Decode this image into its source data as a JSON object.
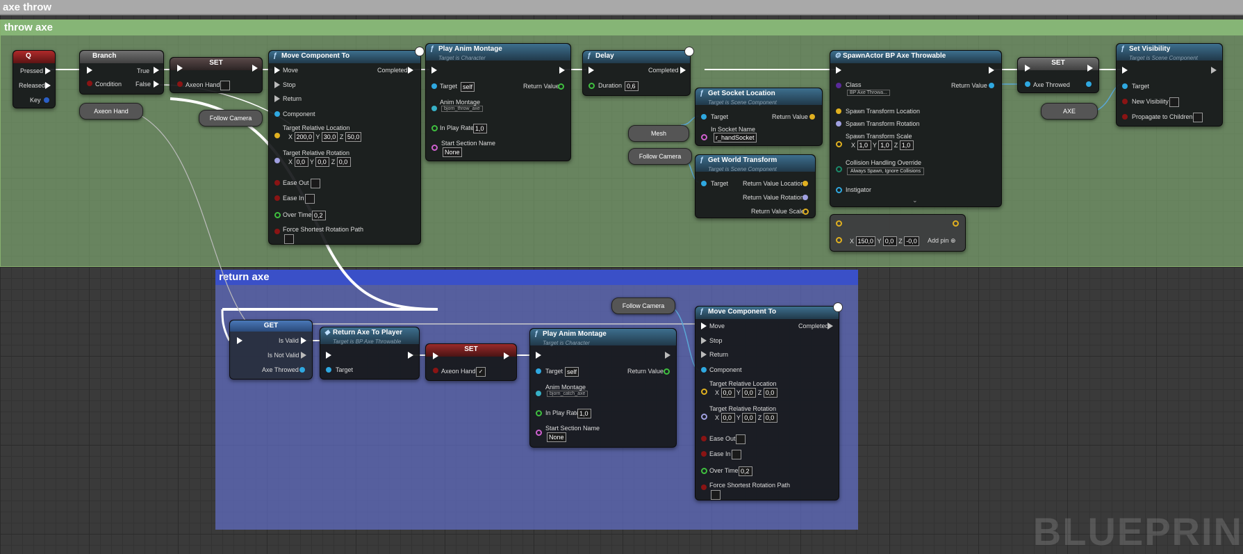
{
  "tab_title": "axe throw",
  "comments": {
    "throw": "throw axe",
    "return": "return axe"
  },
  "watermark": "BLUEPRIN",
  "nodes": {
    "q": {
      "title": "Q",
      "pressed": "Pressed",
      "released": "Released",
      "key": "Key"
    },
    "branch": {
      "title": "Branch",
      "condition": "Condition",
      "true": "True",
      "false": "False"
    },
    "set1": {
      "title": "SET",
      "var": "Axeon Hand"
    },
    "axeon_get": "Axeon Hand",
    "follow1": "Follow Camera",
    "move1": {
      "title": "Move Component To",
      "move": "Move",
      "stop": "Stop",
      "return": "Return",
      "completed": "Completed",
      "component": "Component",
      "loc_label": "Target Relative Location",
      "loc": [
        "200,0",
        "30,0",
        "50,0"
      ],
      "rot_label": "Target Relative Rotation",
      "rot": [
        "0,0",
        "0,0",
        "0,0"
      ],
      "ease_out": "Ease Out",
      "ease_in": "Ease In",
      "over_time": "Over Time",
      "over_time_val": "0,2",
      "force": "Force Shortest Rotation Path"
    },
    "anim1": {
      "title": "Play Anim Montage",
      "subtitle": "Target is Character",
      "target": "Target",
      "target_val": "self",
      "return_value": "Return Value",
      "montage": "Anim Montage",
      "montage_val": "bjorn_throw_axe",
      "rate": "In Play Rate",
      "rate_val": "1,0",
      "section": "Start Section Name",
      "section_val": "None"
    },
    "delay": {
      "title": "Delay",
      "completed": "Completed",
      "duration": "Duration",
      "duration_val": "0,6"
    },
    "mesh": "Mesh",
    "follow2": "Follow Camera",
    "socket": {
      "title": "Get Socket Location",
      "subtitle": "Target is Scene Component",
      "target": "Target",
      "return_value": "Return Value",
      "socket_name": "In Socket Name",
      "socket_val": "r_handSocket"
    },
    "world": {
      "title": "Get World Transform",
      "subtitle": "Target is Scene Component",
      "target": "Target",
      "loc": "Return Value Location",
      "rot": "Return Value Rotation",
      "scale": "Return Value Scale"
    },
    "spawn": {
      "title": "SpawnActor BP Axe Throwable",
      "class": "Class",
      "class_val": "BP Axe Throwa...",
      "return_value": "Return Value",
      "loc": "Spawn Transform Location",
      "rot": "Spawn Transform Rotation",
      "scale": "Spawn Transform Scale",
      "scale_vals": [
        "1,0",
        "1,0",
        "1,0"
      ],
      "collision": "Collision Handling Override",
      "collision_val": "Always Spawn, Ignore Collisions",
      "instigator": "Instigator"
    },
    "add": {
      "vals": [
        "150,0",
        "0,0",
        "-0,0"
      ],
      "add_pin": "Add pin"
    },
    "set2": {
      "title": "SET",
      "var": "Axe Throwed"
    },
    "axe": "AXE",
    "vis": {
      "title": "Set Visibility",
      "subtitle": "Target is Scene Component",
      "target": "Target",
      "new_vis": "New Visibility",
      "propagate": "Propagate to Children"
    },
    "follow3": "Follow Camera",
    "get": {
      "title": "GET",
      "valid": "Is Valid",
      "not_valid": "Is Not Valid",
      "axe_throwed": "Axe Throwed"
    },
    "ret": {
      "title": "Return Axe To Player",
      "subtitle": "Target is BP Axe Throwable",
      "target": "Target"
    },
    "set3": {
      "title": "SET",
      "var": "Axeon Hand"
    },
    "anim2": {
      "title": "Play Anim Montage",
      "subtitle": "Target is Character",
      "target": "Target",
      "target_val": "self",
      "return_value": "Return Value",
      "montage": "Anim Montage",
      "montage_val": "bjorn_catch_axe",
      "rate": "In Play Rate",
      "rate_val": "1,0",
      "section": "Start Section Name",
      "section_val": "None"
    },
    "move2": {
      "title": "Move Component To",
      "move": "Move",
      "stop": "Stop",
      "return": "Return",
      "completed": "Completed",
      "component": "Component",
      "loc_label": "Target Relative Location",
      "loc": [
        "0,0",
        "0,0",
        "0,0"
      ],
      "rot_label": "Target Relative Rotation",
      "rot": [
        "0,0",
        "0,0",
        "0,0"
      ],
      "ease_out": "Ease Out",
      "ease_in": "Ease In",
      "over_time": "Over Time",
      "over_time_val": "0,2",
      "force": "Force Shortest Rotation Path"
    }
  },
  "axis": {
    "x": "X",
    "y": "Y",
    "z": "Z"
  }
}
